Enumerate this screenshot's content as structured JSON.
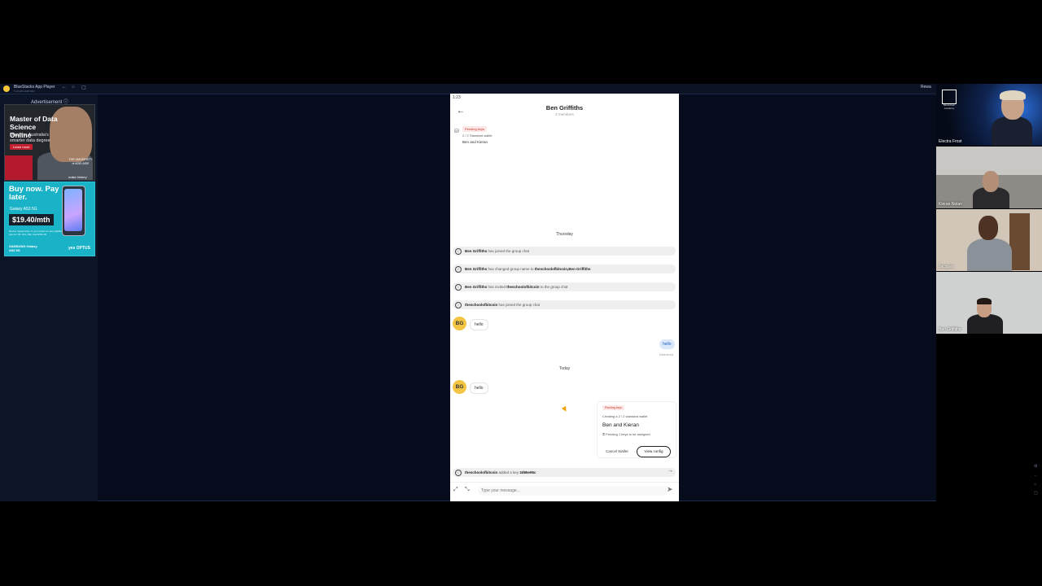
{
  "bluestacks": {
    "title": "BlueStacks App Player",
    "subtitle": "5.13.200.1026  N64",
    "right_label": "Rewa",
    "controls": [
      "←",
      "⌂",
      "▢"
    ]
  },
  "ads": {
    "label": "Advertisement ⓘ",
    "ad1": {
      "title": "Master of Data Science Online",
      "subtitle": "Discover Australia's smarter data degree",
      "button": "Learn more",
      "university": "THE UNIVERSITY of ADELAIDE",
      "tagline": "make history"
    },
    "ad2": {
      "title": "Buy now. Pay later.",
      "model": "Galaxy A53 5G",
      "price": "$19.40/mth",
      "fine_print": "Device repayments. If you remain on any eligible plan for 36 mths, Min cost $762.00",
      "brand": "SAMSUNG Galaxy A53 5G",
      "carrier": "yes OPTUS"
    }
  },
  "phone": {
    "status_time": "1:23",
    "header": {
      "title": "Ben Griffiths",
      "members": "2 members"
    },
    "pending": {
      "badge": "Pending keys",
      "description": "2 / 2 Standard wallet",
      "name": "Ben and Kieran"
    },
    "day1": "Thursday",
    "system_messages": [
      {
        "user": "Ben Griffiths",
        "text": " has joined the group chat"
      },
      {
        "user": "Ben Griffiths",
        "text": " has changed group name to ",
        "extra": "theschoolofbitcoin,Ben Griffiths"
      },
      {
        "user": "Ben Griffiths",
        "text": " has invited ",
        "extra": "theschoolofbitcoin",
        "tail": " to the group chat"
      },
      {
        "user": "theschoolofbitcoin",
        "text": " has joined the group chat"
      }
    ],
    "msg1": {
      "avatar": "BG",
      "text": "hello"
    },
    "out": {
      "text": "hello",
      "status": "Delivered"
    },
    "day2": "Today",
    "msg2": {
      "avatar": "BG",
      "text": "hello"
    },
    "wallet_card": {
      "badge": "Pending keys",
      "description": "Creating a 2 / 2 standard wallet",
      "name": "Ben and Kieran",
      "keys": "Pending 1 keys to be assigned"
    },
    "cancel_label": "Cancel Wallet",
    "view_label": "View config",
    "key_added": {
      "user": "theschoolofbitcoin",
      "text": " added a key ",
      "key": "3d86e95c"
    },
    "input_placeholder": "Type your message..."
  },
  "participants": [
    {
      "name": "Electra Frost",
      "logo_label": "Blockchain Academy"
    },
    {
      "name": "Kieran Nolan"
    },
    {
      "name": "Jacques"
    },
    {
      "name": "Ben Griffiths"
    }
  ],
  "colors": {
    "avatar": "#f4c542",
    "pending_badge": "#c0392b",
    "outgoing_bubble": "#dbe8fb",
    "bluestacks_bg": "#0b1325"
  }
}
